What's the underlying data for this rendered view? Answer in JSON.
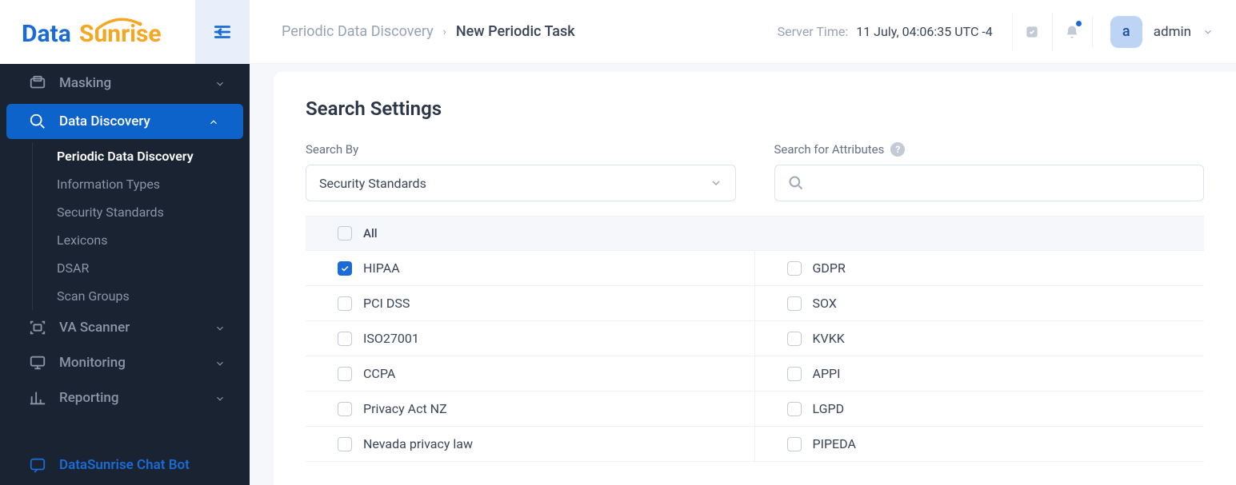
{
  "brand": {
    "name1": "Data",
    "name2": "Sunrise"
  },
  "sidebar": {
    "items": [
      {
        "label": "Masking"
      },
      {
        "label": "Data Discovery"
      },
      {
        "label": "VA Scanner"
      },
      {
        "label": "Monitoring"
      },
      {
        "label": "Reporting"
      }
    ],
    "subitems": [
      {
        "label": "Periodic Data Discovery"
      },
      {
        "label": "Information Types"
      },
      {
        "label": "Security Standards"
      },
      {
        "label": "Lexicons"
      },
      {
        "label": "DSAR"
      },
      {
        "label": "Scan Groups"
      }
    ],
    "chatbot": "DataSunrise Chat Bot"
  },
  "breadcrumb": {
    "parent": "Periodic Data Discovery",
    "current": "New Periodic Task"
  },
  "server_time": {
    "label": "Server Time:",
    "value": "11 July, 04:06:35  UTC -4"
  },
  "user": {
    "initial": "a",
    "name": "admin"
  },
  "page": {
    "title": "Search Settings",
    "search_by_label": "Search By",
    "attributes_label": "Search for Attributes",
    "select_value": "Security Standards",
    "all_label": "All",
    "standards_left": [
      "HIPAA",
      "PCI DSS",
      "ISO27001",
      "CCPA",
      "Privacy Act NZ",
      "Nevada privacy law"
    ],
    "standards_right": [
      "GDPR",
      "SOX",
      "KVKK",
      "APPI",
      "LGPD",
      "PIPEDA"
    ],
    "checked": {
      "HIPAA": true
    }
  }
}
